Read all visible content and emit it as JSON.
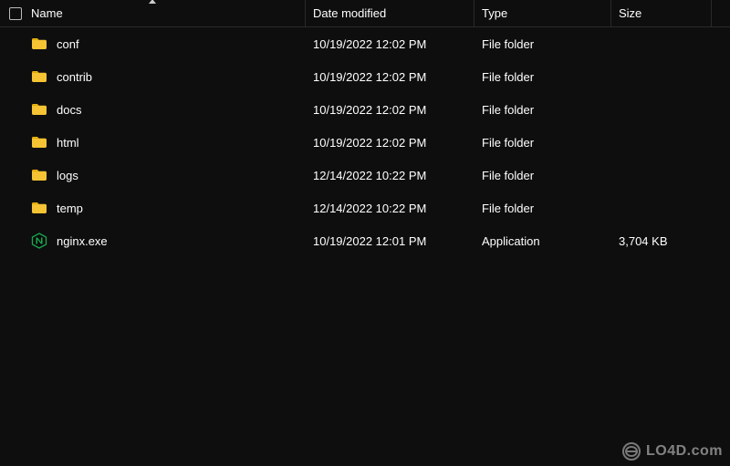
{
  "columns": {
    "name": "Name",
    "date": "Date modified",
    "type": "Type",
    "size": "Size"
  },
  "items": [
    {
      "name": "conf",
      "date": "10/19/2022 12:02 PM",
      "type": "File folder",
      "size": "",
      "icon": "folder"
    },
    {
      "name": "contrib",
      "date": "10/19/2022 12:02 PM",
      "type": "File folder",
      "size": "",
      "icon": "folder"
    },
    {
      "name": "docs",
      "date": "10/19/2022 12:02 PM",
      "type": "File folder",
      "size": "",
      "icon": "folder"
    },
    {
      "name": "html",
      "date": "10/19/2022 12:02 PM",
      "type": "File folder",
      "size": "",
      "icon": "folder"
    },
    {
      "name": "logs",
      "date": "12/14/2022 10:22 PM",
      "type": "File folder",
      "size": "",
      "icon": "folder"
    },
    {
      "name": "temp",
      "date": "12/14/2022 10:22 PM",
      "type": "File folder",
      "size": "",
      "icon": "folder"
    },
    {
      "name": "nginx.exe",
      "date": "10/19/2022 12:01 PM",
      "type": "Application",
      "size": "3,704 KB",
      "icon": "nginx"
    }
  ],
  "watermark": "LO4D.com"
}
